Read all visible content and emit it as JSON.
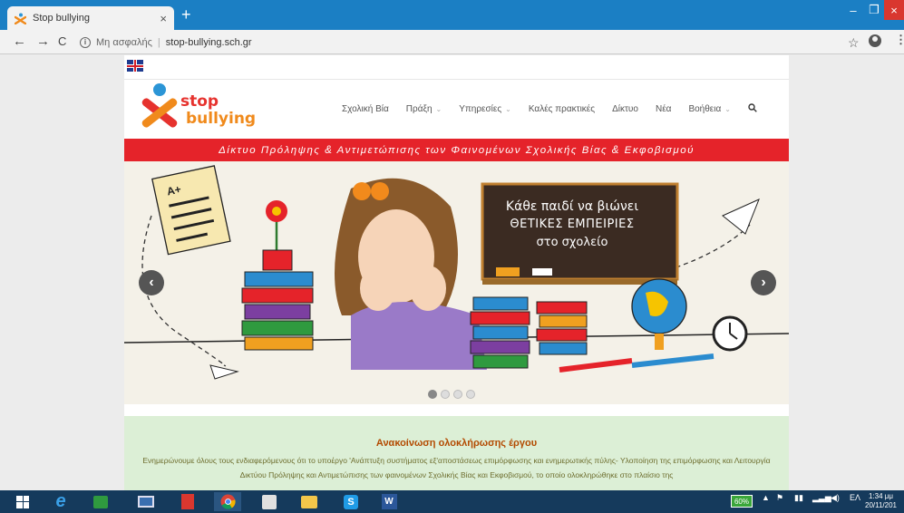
{
  "browser": {
    "tab_title": "Stop bullying",
    "tab_close": "×",
    "new_tab": "+",
    "nav": {
      "back": "←",
      "forward": "→",
      "reload": "C"
    },
    "security_label": "Μη ασφαλής",
    "url": "stop-bullying.sch.gr",
    "window": {
      "minimize": "–",
      "maximize": "❐",
      "close": "×"
    },
    "menu": "⋮",
    "star": "☆"
  },
  "site": {
    "logo": {
      "line1": "stop",
      "line2": "bullying"
    },
    "nav": [
      {
        "label": "Σχολική Βία",
        "dropdown": false
      },
      {
        "label": "Πράξη",
        "dropdown": true
      },
      {
        "label": "Υπηρεσίες",
        "dropdown": true
      },
      {
        "label": "Καλές πρακτικές",
        "dropdown": false
      },
      {
        "label": "Δίκτυο",
        "dropdown": false
      },
      {
        "label": "Νέα",
        "dropdown": false
      },
      {
        "label": "Βοήθεια",
        "dropdown": true
      }
    ],
    "nav_caret": "⌄",
    "search_icon": "🔍",
    "banner": "Δίκτυο Πρόληψης & Αντιμετώπισης των Φαινομένων Σχολικής Βίας & Εκφοβισμού",
    "slider": {
      "board_line1": "Κάθε παιδί να βιώνει",
      "board_line2": "ΘΕΤΙΚΕΣ ΕΜΠΕΙΡΙΕΣ",
      "board_line3": "στο σχολείο",
      "prev": "‹",
      "next": "›",
      "paper_grade": "A+",
      "dots": 4,
      "active_dot": 0
    },
    "announcement": {
      "title": "Ανακοίνωση ολοκλήρωσης έργου",
      "text": "Ενημερώνουμε όλους τους ενδιαφερόμενους ότι το υποέργο 'Ανάπτυξη συστήματος εξ'αποστάσεως επιμόρφωσης και ενημερωτικής πύλης- Υλοποίηση της επιμόρφωσης και Λειτουργία Δικτύου Πρόληψης και Αντιμετώπισης των φαινομένων Σχολικής Βίας και Εκφοβισμού, το οποίο ολοκληρώθηκε στο πλαίσιο της"
    }
  },
  "taskbar": {
    "battery": "60%",
    "language": "ΕΛ",
    "time": "1:34 μμ",
    "date": "20/11/201"
  },
  "colors": {
    "chrome_tabstrip": "#1b7fc4",
    "banner_red": "#e5232a",
    "announce_bg": "#dcefd6",
    "announce_title": "#b34a00"
  }
}
